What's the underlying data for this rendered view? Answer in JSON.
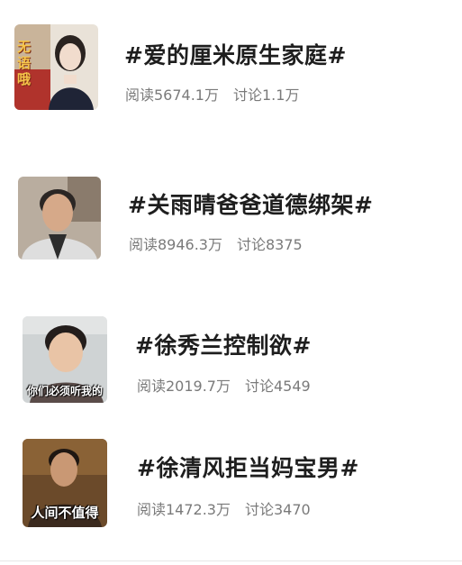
{
  "topics": [
    {
      "title": "#爱的厘米原生家庭#",
      "read_count": "阅读5674.1万",
      "discussion_count": "讨论1.1万",
      "thumbnail_caption": "无语哦"
    },
    {
      "title": "#关雨晴爸爸道德绑架#",
      "read_count": "阅读8946.3万",
      "discussion_count": "讨论8375",
      "thumbnail_caption": ""
    },
    {
      "title": "#徐秀兰控制欲#",
      "read_count": "阅读2019.7万",
      "discussion_count": "讨论4549",
      "thumbnail_caption": "你们必须听我的"
    },
    {
      "title": "#徐清风拒当妈宝男#",
      "read_count": "阅读1472.3万",
      "discussion_count": "讨论3470",
      "thumbnail_caption": "人间不值得"
    }
  ],
  "colors": {
    "title": "#1e1e1e",
    "stats": "#7a7a7a",
    "background": "#ffffff"
  }
}
